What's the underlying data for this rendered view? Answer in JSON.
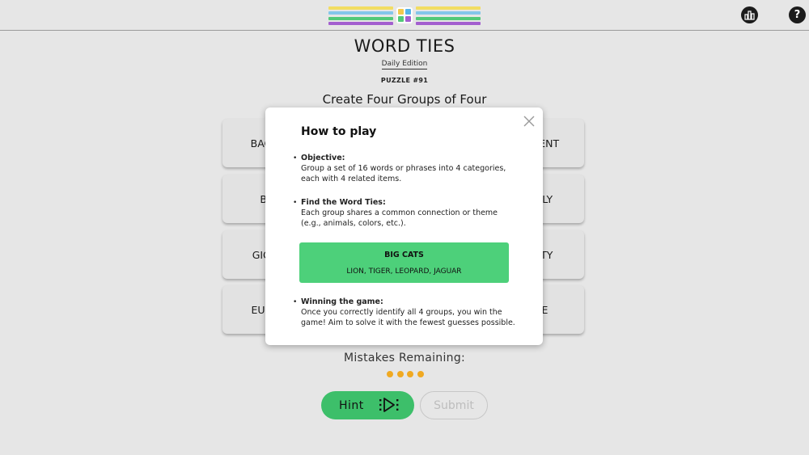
{
  "header": {
    "logo": {
      "bar_colors": [
        "#f2dd62",
        "#84c6ea",
        "#52c978",
        "#a35fcf"
      ],
      "tile_colors": [
        "#f2c94c",
        "#56b4e9",
        "#52c978",
        "#a35fcf"
      ]
    },
    "icons": {
      "stats": "stats-bar-icon",
      "help": "question-mark-icon"
    },
    "help_glyph": "?"
  },
  "game": {
    "title": "WORD TIES",
    "edition": "Daily Edition",
    "puzzle_number": "PUZZLE #91",
    "instructions": "Create Four Groups of Four",
    "tiles": [
      [
        "BAGU",
        "",
        "",
        "TMENT"
      ],
      [
        "BI",
        "",
        "",
        "MILY"
      ],
      [
        "GIGA",
        "",
        "",
        "CITY"
      ],
      [
        "EUPH",
        "",
        "",
        "EE"
      ]
    ],
    "mistakes_label": "Mistakes Remaining:",
    "mistakes_remaining": 4,
    "mistake_dot_color": "#f0a922"
  },
  "actions": {
    "hint_label": "Hint",
    "submit_label": "Submit"
  },
  "modal": {
    "title": "How to play",
    "sections": [
      {
        "heading": "Objective:",
        "body": "Group a set of 16 words or phrases into 4 categories, each with 4 related items."
      },
      {
        "heading": "Find the Word Ties:",
        "body": "Each group shares a common connection or theme (e.g., animals, colors, etc.)."
      },
      {
        "heading": "Winning the game:",
        "body": "Once you correctly identify all 4 groups, you win the game! Aim to solve it with the fewest guesses possible."
      }
    ],
    "example": {
      "category": "BIG CATS",
      "items": "LION, TIGER, LEOPARD, JAGUAR",
      "color": "#4dd07a"
    }
  }
}
